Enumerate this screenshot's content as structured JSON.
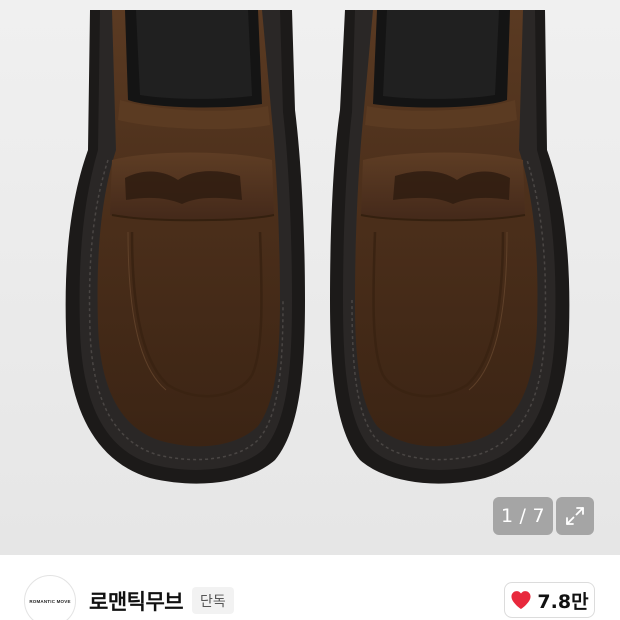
{
  "gallery": {
    "current_index": "1",
    "separator": "/",
    "total": "7",
    "photo_subject": "brown suede penny loafers"
  },
  "store": {
    "logo_text": "ROMANTIC MOVE",
    "name": "로맨틱무브",
    "badge": "단독"
  },
  "like": {
    "count": "7.8만",
    "heart_color": "#e8283c"
  },
  "icons": {
    "expand": "expand-arrows-icon",
    "heart": "heart-icon"
  }
}
